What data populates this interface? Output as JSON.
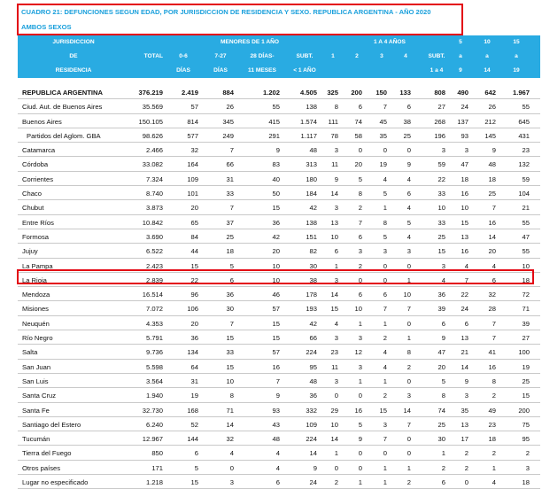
{
  "title": {
    "line1": "CUADRO 21: DEFUNCIONES SEGUN EDAD, POR JURISDICCION DE RESIDENCIA Y SEXO.  REPUBLICA ARGENTINA - AÑO 2020",
    "line2": "AMBOS SEXOS"
  },
  "header": {
    "jurisdiccion": [
      "JURISDICCION",
      "DE",
      "RESIDENCIA"
    ],
    "total": "TOTAL",
    "menores_group": "MENORES DE 1 AÑO",
    "uno_a_cuatro_group": "1 A 4 AÑOS",
    "col_0_6": [
      "0-6",
      "DÍAS"
    ],
    "col_7_27": [
      "7-27",
      "DÍAS"
    ],
    "col_28": [
      "28 DÍAS-",
      "11 MESES"
    ],
    "col_subt_menor": [
      "SUBT.",
      "< 1 AÑO"
    ],
    "col_1": "1",
    "col_2": "2",
    "col_3": "3",
    "col_4": "4",
    "col_subt_1a4": [
      "SUBT.",
      "1 a 4"
    ],
    "col_5_9": [
      "5",
      "a",
      "9"
    ],
    "col_10_14": [
      "10",
      "a",
      "14"
    ],
    "col_15_19": [
      "15",
      "a",
      "19"
    ]
  },
  "rows": [
    {
      "name": "REPUBLICA ARGENTINA",
      "vals": [
        "376.219",
        "2.419",
        "884",
        "1.202",
        "4.505",
        "325",
        "200",
        "150",
        "133",
        "808",
        "490",
        "642",
        "1.967"
      ]
    },
    {
      "name": "Ciud. Aut. de Buenos Aires",
      "vals": [
        "35.569",
        "57",
        "26",
        "55",
        "138",
        "8",
        "6",
        "7",
        "6",
        "27",
        "24",
        "26",
        "55"
      ]
    },
    {
      "name": "Buenos Aires",
      "vals": [
        "150.105",
        "814",
        "345",
        "415",
        "1.574",
        "111",
        "74",
        "45",
        "38",
        "268",
        "137",
        "212",
        "645"
      ]
    },
    {
      "name": "Partidos del Aglom. GBA",
      "vals": [
        "98.626",
        "577",
        "249",
        "291",
        "1.117",
        "78",
        "58",
        "35",
        "25",
        "196",
        "93",
        "145",
        "431"
      ]
    },
    {
      "name": "Catamarca",
      "vals": [
        "2.466",
        "32",
        "7",
        "9",
        "48",
        "3",
        "0",
        "0",
        "0",
        "3",
        "3",
        "9",
        "23"
      ]
    },
    {
      "name": "Córdoba",
      "vals": [
        "33.082",
        "164",
        "66",
        "83",
        "313",
        "11",
        "20",
        "19",
        "9",
        "59",
        "47",
        "48",
        "132"
      ]
    },
    {
      "name": "Corrientes",
      "vals": [
        "7.324",
        "109",
        "31",
        "40",
        "180",
        "9",
        "5",
        "4",
        "4",
        "22",
        "18",
        "18",
        "59"
      ]
    },
    {
      "name": "Chaco",
      "vals": [
        "8.740",
        "101",
        "33",
        "50",
        "184",
        "14",
        "8",
        "5",
        "6",
        "33",
        "16",
        "25",
        "104"
      ]
    },
    {
      "name": "Chubut",
      "vals": [
        "3.873",
        "20",
        "7",
        "15",
        "42",
        "3",
        "2",
        "1",
        "4",
        "10",
        "10",
        "7",
        "21"
      ]
    },
    {
      "name": "Entre Ríos",
      "vals": [
        "10.842",
        "65",
        "37",
        "36",
        "138",
        "13",
        "7",
        "8",
        "5",
        "33",
        "15",
        "16",
        "55"
      ]
    },
    {
      "name": "Formosa",
      "vals": [
        "3.690",
        "84",
        "25",
        "42",
        "151",
        "10",
        "6",
        "5",
        "4",
        "25",
        "13",
        "14",
        "47"
      ]
    },
    {
      "name": "Jujuy",
      "vals": [
        "6.522",
        "44",
        "18",
        "20",
        "82",
        "6",
        "3",
        "3",
        "3",
        "15",
        "16",
        "20",
        "55"
      ]
    },
    {
      "name": "La Pampa",
      "vals": [
        "2.423",
        "15",
        "5",
        "10",
        "30",
        "1",
        "2",
        "0",
        "0",
        "3",
        "4",
        "4",
        "10"
      ]
    },
    {
      "name": "La Rioja",
      "vals": [
        "2.839",
        "22",
        "6",
        "10",
        "38",
        "3",
        "0",
        "0",
        "1",
        "4",
        "7",
        "6",
        "18"
      ]
    },
    {
      "name": "Mendoza",
      "vals": [
        "16.514",
        "96",
        "36",
        "46",
        "178",
        "14",
        "6",
        "6",
        "10",
        "36",
        "22",
        "32",
        "72"
      ]
    },
    {
      "name": "Misiones",
      "vals": [
        "7.072",
        "106",
        "30",
        "57",
        "193",
        "15",
        "10",
        "7",
        "7",
        "39",
        "24",
        "28",
        "71"
      ]
    },
    {
      "name": "Neuquén",
      "vals": [
        "4.353",
        "20",
        "7",
        "15",
        "42",
        "4",
        "1",
        "1",
        "0",
        "6",
        "6",
        "7",
        "39"
      ]
    },
    {
      "name": "Río Negro",
      "vals": [
        "5.791",
        "36",
        "15",
        "15",
        "66",
        "3",
        "3",
        "2",
        "1",
        "9",
        "13",
        "7",
        "27"
      ]
    },
    {
      "name": "Salta",
      "vals": [
        "9.736",
        "134",
        "33",
        "57",
        "224",
        "23",
        "12",
        "4",
        "8",
        "47",
        "21",
        "41",
        "100"
      ]
    },
    {
      "name": "San Juan",
      "vals": [
        "5.598",
        "64",
        "15",
        "16",
        "95",
        "11",
        "3",
        "4",
        "2",
        "20",
        "14",
        "16",
        "19"
      ]
    },
    {
      "name": "San Luis",
      "vals": [
        "3.564",
        "31",
        "10",
        "7",
        "48",
        "3",
        "1",
        "1",
        "0",
        "5",
        "9",
        "8",
        "25"
      ]
    },
    {
      "name": "Santa Cruz",
      "vals": [
        "1.940",
        "19",
        "8",
        "9",
        "36",
        "0",
        "0",
        "2",
        "3",
        "8",
        "3",
        "2",
        "15"
      ]
    },
    {
      "name": "Santa Fe",
      "vals": [
        "32.730",
        "168",
        "71",
        "93",
        "332",
        "29",
        "16",
        "15",
        "14",
        "74",
        "35",
        "49",
        "200"
      ]
    },
    {
      "name": "Santiago del Estero",
      "vals": [
        "6.240",
        "52",
        "14",
        "43",
        "109",
        "10",
        "5",
        "3",
        "7",
        "25",
        "13",
        "23",
        "75"
      ]
    },
    {
      "name": "Tucumán",
      "vals": [
        "12.967",
        "144",
        "32",
        "48",
        "224",
        "14",
        "9",
        "7",
        "0",
        "30",
        "17",
        "18",
        "95"
      ]
    },
    {
      "name": "Tierra del Fuego",
      "vals": [
        "850",
        "6",
        "4",
        "4",
        "14",
        "1",
        "0",
        "0",
        "0",
        "1",
        "2",
        "2",
        "2"
      ]
    },
    {
      "name": "Otros países",
      "vals": [
        "171",
        "5",
        "0",
        "4",
        "9",
        "0",
        "0",
        "1",
        "1",
        "2",
        "2",
        "1",
        "3"
      ]
    },
    {
      "name": "Lugar no especificado",
      "vals": [
        "1.218",
        "15",
        "3",
        "6",
        "24",
        "2",
        "1",
        "1",
        "2",
        "6",
        "0",
        "4",
        "18"
      ]
    }
  ]
}
